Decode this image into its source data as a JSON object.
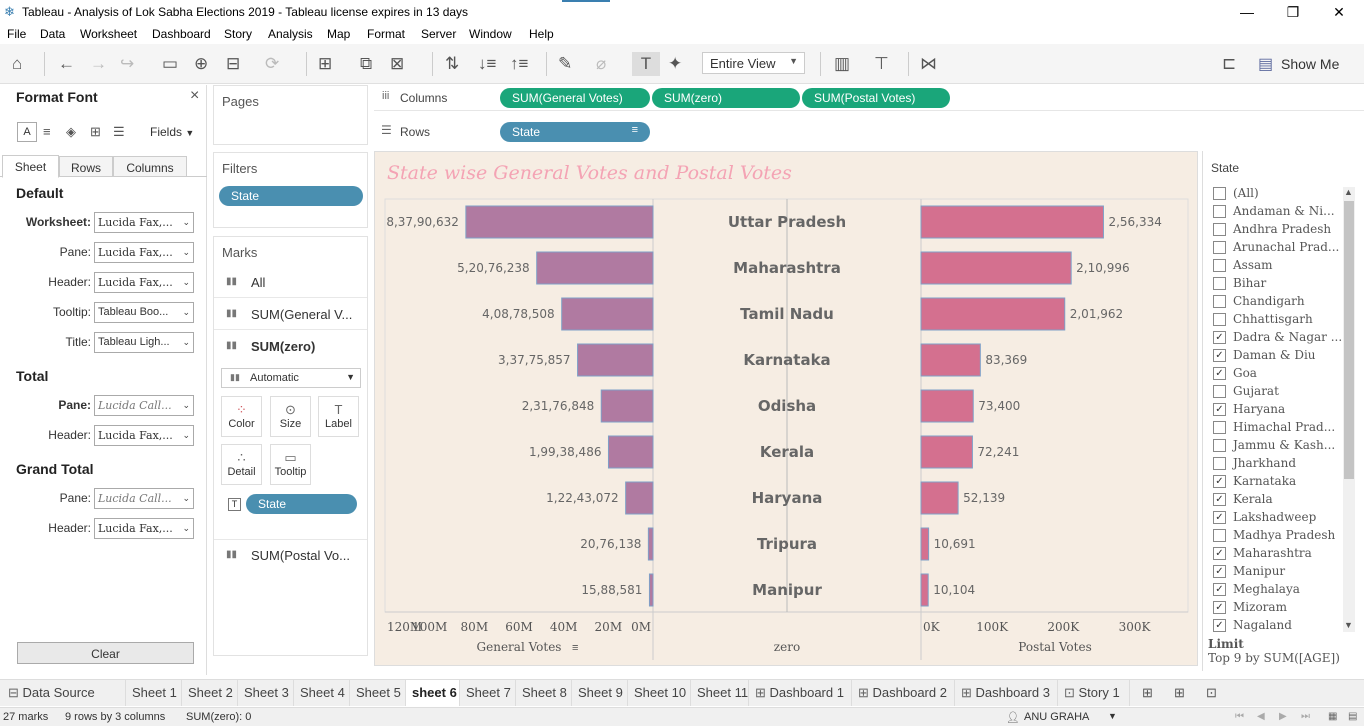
{
  "window": {
    "title": "Tableau - Analysis of  Lok Sabha Elections 2019 - Tableau license expires in 13 days",
    "minimize": "—",
    "restore": "❐",
    "close": "✕"
  },
  "menu": [
    "File",
    "Data",
    "Worksheet",
    "Dashboard",
    "Story",
    "Analysis",
    "Map",
    "Format",
    "Server",
    "Window",
    "Help"
  ],
  "toolbar": {
    "view_select": "Entire View",
    "show_me": "Show Me"
  },
  "format_panel": {
    "title": "Format Font",
    "close": "×",
    "fields_label": "Fields",
    "tabs": [
      "Sheet",
      "Rows",
      "Columns"
    ],
    "default_heading": "Default",
    "default_rows": [
      {
        "label": "Worksheet:",
        "value": "Lucida Fax,..."
      },
      {
        "label": "Pane:",
        "value": "Lucida Fax,..."
      },
      {
        "label": "Header:",
        "value": "Lucida Fax,..."
      },
      {
        "label": "Tooltip:",
        "value": "Tableau Boo..."
      },
      {
        "label": "Title:",
        "value": "Tableau Ligh..."
      }
    ],
    "total_heading": "Total",
    "total_rows": [
      {
        "label": "Pane:",
        "value": "Lucida Call..."
      },
      {
        "label": "Header:",
        "value": "Lucida Fax,..."
      }
    ],
    "grand_total_heading": "Grand Total",
    "grand_total_rows": [
      {
        "label": "Pane:",
        "value": "Lucida Call..."
      },
      {
        "label": "Header:",
        "value": "Lucida Fax,..."
      }
    ],
    "clear_button": "Clear"
  },
  "cards": {
    "pages": "Pages",
    "filters": "Filters",
    "filter_pill": "State",
    "marks": "Marks",
    "marks_rows": [
      "All",
      "SUM(General V...",
      "SUM(zero)"
    ],
    "mark_type": "Automatic",
    "mark_buttons": [
      "Color",
      "Size",
      "Label",
      "Detail",
      "Tooltip"
    ],
    "mark_pill": "State",
    "postal_row": "SUM(Postal Vo..."
  },
  "shelves": {
    "columns_label": "Columns",
    "rows_label": "Rows",
    "columns_pills": [
      "SUM(General Votes)",
      "SUM(zero)",
      "SUM(Postal Votes)"
    ],
    "rows_pill": "State"
  },
  "filter_list": {
    "title": "State",
    "items": [
      {
        "label": "(All)",
        "checked": false
      },
      {
        "label": "Andaman & Ni...",
        "checked": false
      },
      {
        "label": "Andhra Pradesh",
        "checked": false
      },
      {
        "label": "Arunachal Prad...",
        "checked": false
      },
      {
        "label": "Assam",
        "checked": false
      },
      {
        "label": "Bihar",
        "checked": false
      },
      {
        "label": "Chandigarh",
        "checked": false
      },
      {
        "label": "Chhattisgarh",
        "checked": false
      },
      {
        "label": "Dadra & Nagar ...",
        "checked": true
      },
      {
        "label": "Daman & Diu",
        "checked": true
      },
      {
        "label": "Goa",
        "checked": true
      },
      {
        "label": "Gujarat",
        "checked": false
      },
      {
        "label": "Haryana",
        "checked": true
      },
      {
        "label": "Himachal Prad...",
        "checked": false
      },
      {
        "label": "Jammu & Kash...",
        "checked": false
      },
      {
        "label": "Jharkhand",
        "checked": false
      },
      {
        "label": "Karnataka",
        "checked": true
      },
      {
        "label": "Kerala",
        "checked": true
      },
      {
        "label": "Lakshadweep",
        "checked": true
      },
      {
        "label": "Madhya Pradesh",
        "checked": false
      },
      {
        "label": "Maharashtra",
        "checked": true
      },
      {
        "label": "Manipur",
        "checked": true
      },
      {
        "label": "Meghalaya",
        "checked": true
      },
      {
        "label": "Mizoram",
        "checked": true
      },
      {
        "label": "Nagaland",
        "checked": true
      }
    ],
    "limit_label": "Limit",
    "limit_value": "Top 9 by SUM([AGE])"
  },
  "tabs": [
    {
      "label": "Data Source",
      "active": false
    },
    {
      "label": "Sheet 1",
      "active": false
    },
    {
      "label": "Sheet 2",
      "active": false
    },
    {
      "label": "Sheet 3",
      "active": false
    },
    {
      "label": "Sheet 4",
      "active": false
    },
    {
      "label": "Sheet 5",
      "active": false
    },
    {
      "label": "sheet 6",
      "active": true
    },
    {
      "label": "Sheet 7",
      "active": false
    },
    {
      "label": "Sheet 8",
      "active": false
    },
    {
      "label": "Sheet 9",
      "active": false
    },
    {
      "label": "Sheet 10",
      "active": false
    },
    {
      "label": "Sheet 11",
      "active": false
    },
    {
      "label": "Dashboard 1",
      "active": false
    },
    {
      "label": "Dashboard 2",
      "active": false
    },
    {
      "label": "Dashboard 3",
      "active": false
    },
    {
      "label": "Story 1",
      "active": false
    }
  ],
  "status": {
    "marks": "27 marks",
    "rows": "9 rows by 3 columns",
    "sum": "SUM(zero): 0",
    "user": "ANU GRAHA"
  },
  "colors": {
    "general_bar": "#b07aa1",
    "postal_bar": "#d4708f",
    "viz_bg": "#f6ede3",
    "title": "#f4a3b4",
    "pill_blue": "#4a8fb0",
    "pill_green": "#1aa67a"
  },
  "chart_data": {
    "type": "bar",
    "title": "State wise General Votes and Postal Votes",
    "categories": [
      "Uttar Pradesh",
      "Maharashtra",
      "Tamil Nadu",
      "Karnataka",
      "Odisha",
      "Kerala",
      "Haryana",
      "Tripura",
      "Manipur"
    ],
    "series": [
      {
        "name": "General Votes",
        "values": [
          83790632,
          52076238,
          40878508,
          33775857,
          23176848,
          19938486,
          12243072,
          2076138,
          1588581
        ],
        "labels": [
          "8,37,90,632",
          "5,20,76,238",
          "4,08,78,508",
          "3,37,75,857",
          "2,31,76,848",
          "1,99,38,486",
          "1,22,43,072",
          "20,76,138",
          "15,88,581"
        ],
        "axis_ticks": [
          "120M",
          "100M",
          "80M",
          "60M",
          "40M",
          "20M",
          "0M"
        ],
        "xlim": [
          0,
          120000000
        ],
        "reversed": true
      },
      {
        "name": "Postal Votes",
        "values": [
          256334,
          210996,
          201962,
          83369,
          73400,
          72241,
          52139,
          10691,
          10104
        ],
        "labels": [
          "2,56,334",
          "2,10,996",
          "2,01,962",
          "83,369",
          "73,400",
          "72,241",
          "52,139",
          "10,691",
          "10,104"
        ],
        "axis_ticks": [
          "0K",
          "100K",
          "200K",
          "300K"
        ],
        "xlim": [
          0,
          340000
        ]
      }
    ],
    "axis_titles": [
      "General Votes",
      "zero",
      "Postal Votes"
    ]
  }
}
